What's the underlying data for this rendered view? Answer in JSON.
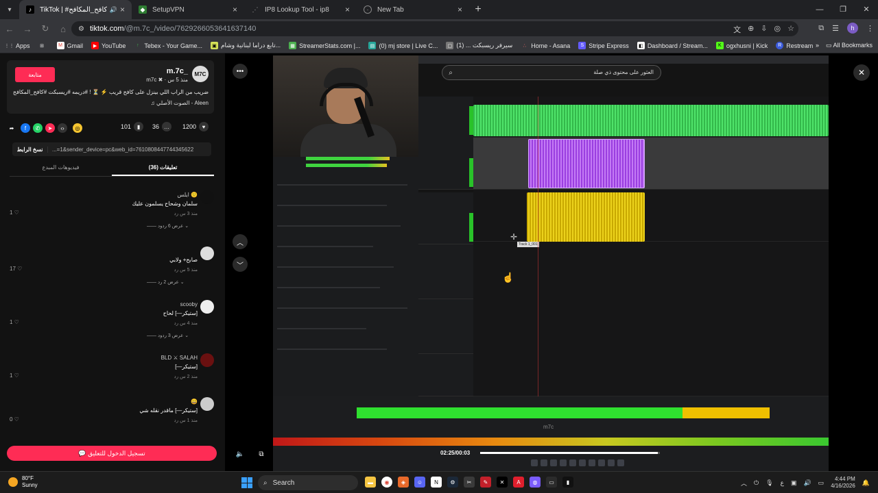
{
  "browser": {
    "tabs": [
      {
        "title": "TikTok | #كافح_المكافح",
        "active": true,
        "icon": "tiktok-icon"
      },
      {
        "title": "SetupVPN",
        "active": false,
        "icon": "vpn-icon"
      },
      {
        "title": "IP8 Lookup Tool - ip8",
        "active": false,
        "icon": "ip8-icon"
      },
      {
        "title": "New Tab",
        "active": false,
        "icon": "globe-icon"
      }
    ],
    "url_host": "tiktok.com",
    "url_path": "/@m.7c_/video/7629266053641637140",
    "profile_initial": "h",
    "bookmarks": [
      {
        "label": "Apps",
        "icon": "grid-icon",
        "color": "#5f6368"
      },
      {
        "label": "",
        "icon": "grid-icon",
        "color": "#5f6368"
      },
      {
        "label": "Gmail",
        "icon": "gmail-icon",
        "color": "#ea4335"
      },
      {
        "label": "YouTube",
        "icon": "youtube-icon",
        "color": "#ff0000"
      },
      {
        "label": "Tebex - Your Game...",
        "icon": "tebex-icon",
        "color": "#3fb950"
      },
      {
        "label": "تابع دراما لبنانية وشام...",
        "icon": "drama-icon",
        "color": "#d4e157"
      },
      {
        "label": "StreamerStats.com |...",
        "icon": "stats-icon",
        "color": "#4caf50"
      },
      {
        "label": "(0) mj store | Live C...",
        "icon": "store-icon",
        "color": "#26a69a"
      },
      {
        "label": "سيرفر ريسبكت ... (1)",
        "icon": "server-icon",
        "color": "#777777"
      },
      {
        "label": "Home - Asana",
        "icon": "asana-icon",
        "color": "#f06a6a"
      },
      {
        "label": "Stripe Express",
        "icon": "stripe-icon",
        "color": "#635bff"
      },
      {
        "label": "Dashboard / Stream...",
        "icon": "dashboard-icon",
        "color": "#aaaaaa"
      },
      {
        "label": "ogxhusni | Kick",
        "icon": "kick-icon",
        "color": "#53fc18"
      },
      {
        "label": "Restream",
        "icon": "restream-icon",
        "color": "#3b5bdb"
      }
    ],
    "all_bookmarks": "All Bookmarks"
  },
  "video_info": {
    "follow_label": "متابعة",
    "username": "m.7c_",
    "nickname": "m7c ✖ · منذ 5 س",
    "avatar_text": "M7C",
    "description": "ضريب من الراب اللي بينزل على كافح قريب ⚡ ⏳ ! #دريمه #ريسبكت #كافح_المكافح",
    "sound": "♫ الصوت الأصلي - Aleen",
    "likes": "1200",
    "comments_count": "36",
    "saves": "101",
    "copy_link_label": "نسخ الرابط",
    "link_text": "...=1&sender_device=pc&web_id=7610808447744345622",
    "tab_comments": "تعليقات (36)",
    "tab_creator_videos": "فيديوهات المبدع"
  },
  "comments": [
    {
      "name": "ايلس 🙂",
      "text": "سلمان وشحاح يسلمون عليك",
      "meta": "منذ 3 س   رد",
      "likes": "1 ♡",
      "replies": "—— عرض 6 ردود ⌄"
    },
    {
      "name": "",
      "text": "صابح+ ولابي",
      "meta": "منذ 5 س   رد",
      "likes": "17 ♡",
      "replies": "—— عرض 2 رد ⌄"
    },
    {
      "name": "scooby",
      "text": "[ستيكر—] لحاح",
      "meta": "منذ 4 س   رد",
      "likes": "1 ♡",
      "replies": "—— عرض 3 ردود ⌄"
    },
    {
      "name": "BLD ⚔ SALAH",
      "text": "[ستيكر—]",
      "meta": "منذ 2 س   رد",
      "likes": "1 ♡",
      "replies": ""
    },
    {
      "name": "😀",
      "text": "[ستيكر—] ماقدر نقله شي",
      "meta": "منذ 1 س   رد",
      "likes": "0 ♡",
      "replies": ""
    }
  ],
  "login_comment_label": "💬 تسجيل الدخول للتعليق",
  "video": {
    "search_text": "العثور على محتوى ذي صلة",
    "watermark": "m7c",
    "time": "02:25/00:03",
    "progress": 0.99,
    "meter_green_fraction": 0.79,
    "meter_yellow_fraction": 0.21,
    "track_label": "Track 1_001"
  },
  "taskbar": {
    "temperature": "80°F",
    "weather": "Sunny",
    "search": "Search",
    "time": "4:44 PM",
    "date": "4/16/2026",
    "lang": "ع"
  },
  "colors": {
    "tiktok_red": "#fe2c55",
    "clip_green": "#4fe36a",
    "clip_purple": "#c47bf5",
    "clip_yellow": "#ecd21c"
  }
}
